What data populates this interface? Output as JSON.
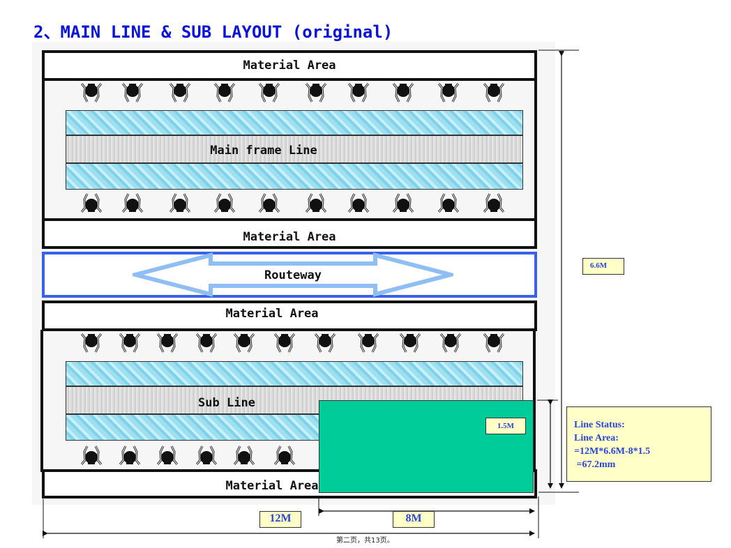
{
  "title": "2、MAIN LINE & SUB LAYOUT (original)",
  "areas": {
    "material_top_1": "Material Area",
    "main_line": "Main frame Line",
    "material_top_2": "Material Area",
    "routeway": "Routeway",
    "material_bottom_1": "Material Area",
    "sub_line": "Sub Line",
    "material_bottom_2": "Material Area"
  },
  "dimensions": {
    "height_total": "6.6M",
    "height_green": "1.5M",
    "width_total": "12M",
    "width_green": "8M"
  },
  "status": {
    "line1": "Line Status:",
    "line2": "Line Area:",
    "line3": "=12M*6.6M-8*1.5",
    "line4": " =67.2mm"
  },
  "colors": {
    "title": "#0a14d8",
    "green_block": "#00cc99",
    "routeway_border": "#3a62e8",
    "routeway_arrow": "#8fbef5",
    "note_bg": "#ffffc8"
  },
  "footer": "第二页，共13页。"
}
